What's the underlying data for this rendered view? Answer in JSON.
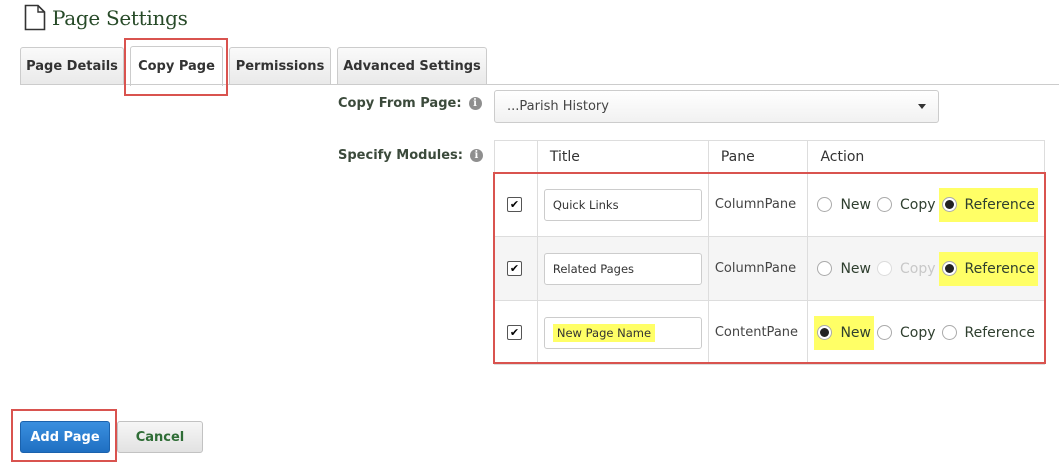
{
  "header": {
    "title": "Page Settings",
    "icon": "page-document-icon"
  },
  "tabs": [
    {
      "label": "Page Details",
      "active": false
    },
    {
      "label": "Copy Page",
      "active": true
    },
    {
      "label": "Permissions",
      "active": false
    },
    {
      "label": "Advanced Settings",
      "active": false
    }
  ],
  "form": {
    "copy_from_label": "Copy From Page:",
    "copy_from_value": "...Parish History",
    "specify_modules_label": "Specify Modules:",
    "info_glyph": "i"
  },
  "modules_table": {
    "columns": [
      "",
      "Title",
      "Pane",
      "Action"
    ],
    "rows": [
      {
        "checked": true,
        "title": "Quick Links",
        "pane": "ColumnPane",
        "actions": {
          "new": "New",
          "copy": "Copy",
          "reference": "Reference"
        },
        "selected": "Reference",
        "copy_disabled": false
      },
      {
        "checked": true,
        "title": "Related Pages",
        "pane": "ColumnPane",
        "actions": {
          "new": "New",
          "copy": "Copy",
          "reference": "Reference"
        },
        "selected": "Reference",
        "copy_disabled": true
      },
      {
        "checked": true,
        "title": "New Page Name",
        "pane": "ContentPane",
        "actions": {
          "new": "New",
          "copy": "Copy",
          "reference": "Reference"
        },
        "selected": "New",
        "copy_disabled": false
      }
    ]
  },
  "buttons": {
    "add_page": "Add Page",
    "cancel": "Cancel"
  },
  "colors": {
    "title_green": "#274a28",
    "highlight_yellow": "#ffff66",
    "callout_red": "#d9534f",
    "primary_blue": "#1f6fc2"
  }
}
